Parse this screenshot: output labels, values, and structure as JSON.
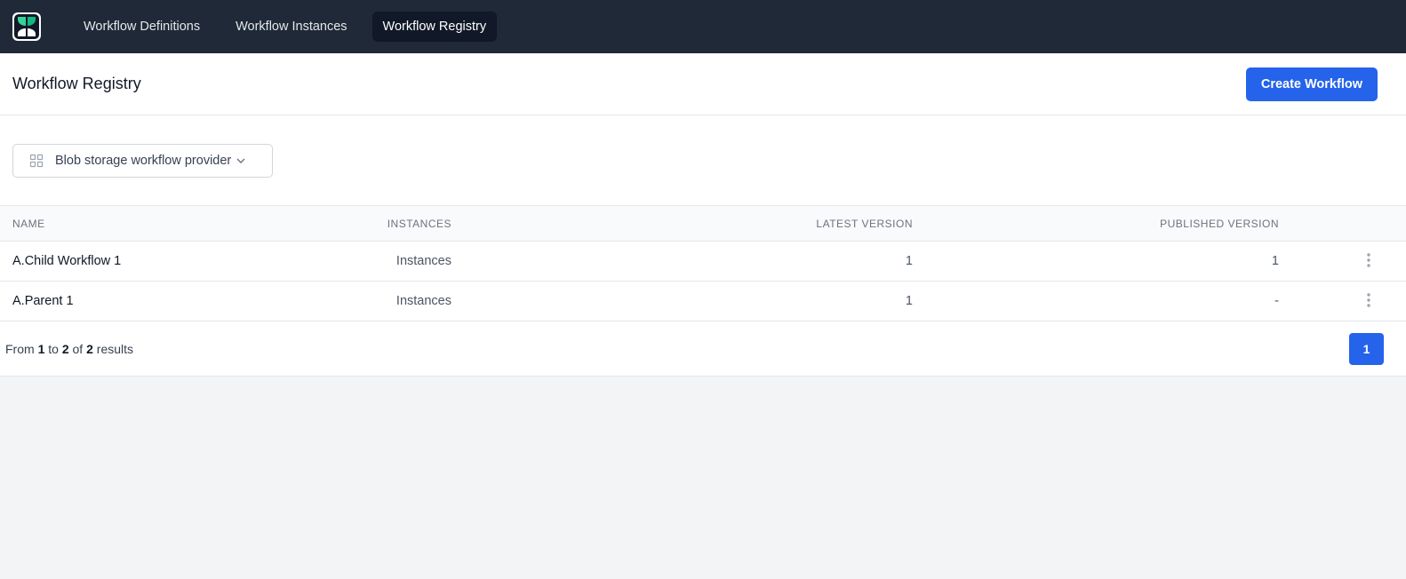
{
  "nav": {
    "links": [
      {
        "label": "Workflow Definitions",
        "active": false
      },
      {
        "label": "Workflow Instances",
        "active": false
      },
      {
        "label": "Workflow Registry",
        "active": true
      }
    ]
  },
  "header": {
    "title": "Workflow Registry",
    "create_label": "Create Workflow"
  },
  "filter": {
    "provider_label": "Blob storage workflow provider"
  },
  "table": {
    "headers": {
      "name": "Name",
      "instances": "Instances",
      "latest_version": "Latest Version",
      "published_version": "Published Version"
    },
    "rows": [
      {
        "name": "A.Child Workflow 1",
        "instances_link": "Instances",
        "latest_version": "1",
        "published_version": "1"
      },
      {
        "name": "A.Parent 1",
        "instances_link": "Instances",
        "latest_version": "1",
        "published_version": "-"
      }
    ]
  },
  "pagination": {
    "prefix": "From",
    "start": "1",
    "to_word": "to",
    "end": "2",
    "of_word": "of",
    "total": "2",
    "suffix": "results",
    "current_page": "1"
  },
  "colors": {
    "nav_bg": "#1f2937",
    "accent": "#2563eb",
    "page_bg": "#f3f4f6"
  },
  "icons": {
    "logo": "elsa-leaf-logo",
    "provider": "grid-icon",
    "dropdown": "chevron-down-icon",
    "row_menu": "vertical-dots-icon"
  }
}
